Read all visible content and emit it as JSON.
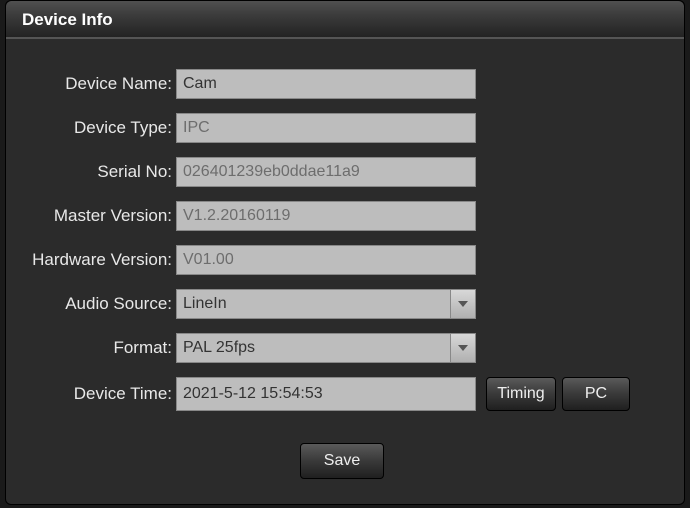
{
  "panel": {
    "title": "Device Info"
  },
  "labels": {
    "deviceName": "Device Name:",
    "deviceType": "Device Type:",
    "serialNo": "Serial No:",
    "masterVersion": "Master Version:",
    "hardwareVersion": "Hardware Version:",
    "audioSource": "Audio Source:",
    "format": "Format:",
    "deviceTime": "Device Time:"
  },
  "values": {
    "deviceName": "Cam",
    "deviceType": "IPC",
    "serialNo": "026401239eb0ddae11a9",
    "masterVersion": "V1.2.20160119",
    "hardwareVersion": "V01.00",
    "audioSource": "LineIn",
    "format": "PAL 25fps",
    "deviceTime": "2021-5-12 15:54:53"
  },
  "buttons": {
    "timing": "Timing",
    "pc": "PC",
    "save": "Save"
  }
}
